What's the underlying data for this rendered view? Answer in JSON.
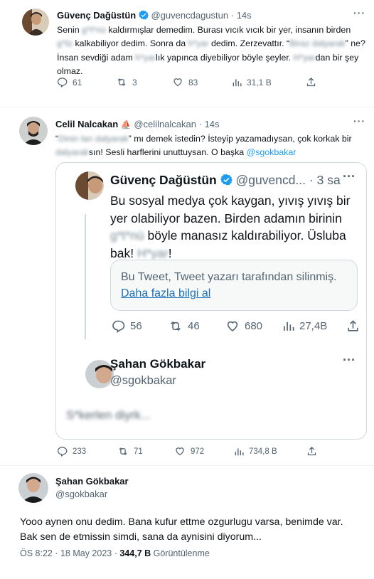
{
  "tweet1": {
    "name": "Güvenç Dağüstün",
    "handle": "@guvencdagustun",
    "time": "14s",
    "body": [
      {
        "t": "Senin ",
        "s": "n"
      },
      {
        "t": "g*t*nü",
        "s": "b"
      },
      {
        "t": " kaldırmışlar demedim. Burası vıcık vıcık bir yer, insanın birden ",
        "s": "n"
      },
      {
        "t": "g*tü",
        "s": "b"
      },
      {
        "t": " kalkabiliyor dedim. Sonra da ",
        "s": "n"
      },
      {
        "t": "h*yar",
        "s": "b"
      },
      {
        "t": " dedim. Zerzevattır. “",
        "s": "n"
      },
      {
        "t": "Biraz dalyarak",
        "s": "b"
      },
      {
        "t": "” ne? İnsan sevdiği adam ",
        "s": "n"
      },
      {
        "t": "h*yar",
        "s": "b"
      },
      {
        "t": "lık yapınca diyebiliyor böyle şeyler. ",
        "s": "n"
      },
      {
        "t": "H*yar",
        "s": "b"
      },
      {
        "t": "dan bir şey olmaz.",
        "s": "n"
      }
    ],
    "stats": {
      "replies": "61",
      "retweets": "3",
      "likes": "83",
      "views": "31,1 B"
    }
  },
  "tweet2": {
    "name": "Celil Nalcakan",
    "name_emoji": "⛵",
    "handle": "@celilnalcakan",
    "time": "14s",
    "body": [
      {
        "t": "“",
        "s": "n"
      },
      {
        "t": "Dinin lan dalyarak",
        "s": "b"
      },
      {
        "t": "” mı demek istedin? İsteyip yazamadıysan, çok korkak bir ",
        "s": "n"
      },
      {
        "t": "dalyarak",
        "s": "b"
      },
      {
        "t": "sın! Sesli harflerini unuttuysan. O başka ",
        "s": "n"
      },
      {
        "t": "@sgokbakar",
        "s": "m"
      }
    ],
    "quote": {
      "name": "Güvenç Dağüstün",
      "handle": "@guvencd...",
      "time": "3 sa",
      "body": [
        {
          "t": "Bu sosyal medya çok kaygan, yıvış yıvış bir yer olabiliyor bazen. Birden adamın birinin ",
          "s": "n"
        },
        {
          "t": "g*t*nü",
          "s": "b"
        },
        {
          "t": " böyle manasız kaldırabiliyor. Üsluba bak! ",
          "s": "n"
        },
        {
          "t": "H*yar",
          "s": "b"
        },
        {
          "t": "!",
          "s": "n"
        }
      ],
      "deleted_notice": "Bu Tweet, Tweet yazarı tarafından silinmiş.",
      "deleted_link": "Daha fazla bilgi al",
      "stats": {
        "replies": "56",
        "retweets": "46",
        "likes": "680",
        "views": "27,4B"
      },
      "inner": {
        "name": "Şahan Gökbakar",
        "handle": "@sgokbakar",
        "text": "S*kerlen diyrk..."
      }
    },
    "stats": {
      "replies": "233",
      "retweets": "71",
      "likes": "972",
      "views": "734,8 B"
    }
  },
  "tweet3": {
    "name": "Şahan Gökbakar",
    "handle": "@sgokbakar",
    "text_line1": "Yooo aynen onu dedim. Bana kufur ettme ozgurlugu varsa, benimde var.",
    "text_line2": "Bak sen de etmissin simdi, sana da aynisini diyorum...",
    "time": "ÖS 8:22 · 18 May 2023 · ",
    "views_count": "344,7 B",
    "views_label": " Görüntülenme"
  },
  "colors": {
    "accent": "#1d9bf0",
    "muted": "#536471",
    "border": "#cfd9de"
  }
}
